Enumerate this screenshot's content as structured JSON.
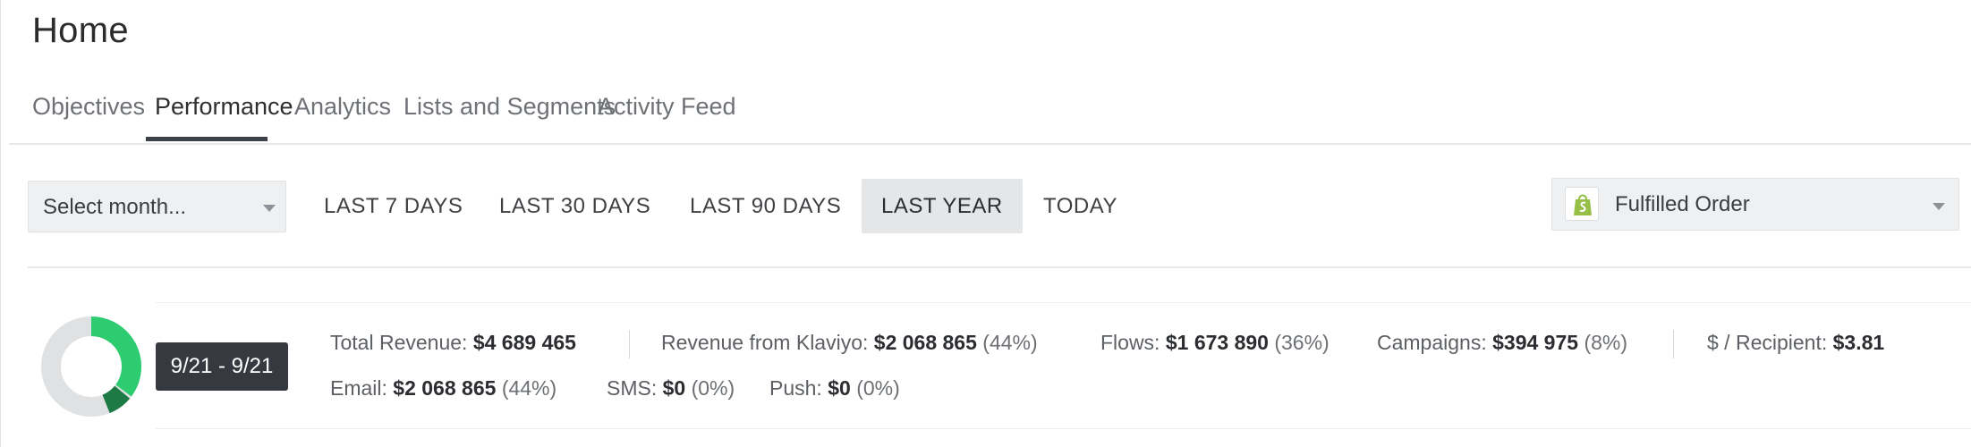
{
  "page": {
    "title": "Home"
  },
  "tabs": [
    {
      "label": "Objectives",
      "active": false
    },
    {
      "label": "Performance",
      "active": true
    },
    {
      "label": "Analytics",
      "active": false
    },
    {
      "label": "Lists and Segments",
      "active": false
    },
    {
      "label": "Activity Feed",
      "active": false
    }
  ],
  "filters": {
    "month_select": {
      "value": "Select month..."
    },
    "ranges": [
      {
        "label": "LAST 7 DAYS",
        "selected": false
      },
      {
        "label": "LAST 30 DAYS",
        "selected": false
      },
      {
        "label": "LAST 90 DAYS",
        "selected": false
      },
      {
        "label": "LAST YEAR",
        "selected": true
      },
      {
        "label": "TODAY",
        "selected": false
      }
    ],
    "metric_select": {
      "value": "Fulfilled Order",
      "icon": "shopify-bag-icon"
    }
  },
  "summary": {
    "tooltip": "9/21 - 9/21",
    "donut": {
      "klaviyo_share": 0.44,
      "flows_share": 0.36,
      "campaigns_share": 0.08
    },
    "row1": [
      {
        "label": "Total Revenue:",
        "value": "$4 689 465",
        "pct": ""
      },
      {
        "label": "Revenue from Klaviyo:",
        "value": "$2 068 865",
        "pct": "(44%)"
      },
      {
        "label": "Flows:",
        "value": "$1 673 890",
        "pct": "(36%)"
      },
      {
        "label": "Campaigns:",
        "value": "$394 975",
        "pct": "(8%)"
      },
      {
        "label": "$ / Recipient:",
        "value": "$3.81",
        "pct": ""
      }
    ],
    "row2": [
      {
        "label": "Email:",
        "value": "$2 068 865",
        "pct": "(44%)"
      },
      {
        "label": "SMS:",
        "value": "$0",
        "pct": "(0%)"
      },
      {
        "label": "Push:",
        "value": "$0",
        "pct": "(0%)"
      }
    ]
  },
  "colors": {
    "donut_track": "#dfe1e3",
    "flows_green": "#2ecc71",
    "campaigns_green": "#1e7a45",
    "tooltip_bg": "#363a40",
    "selected_range_bg": "#e4e6e8"
  }
}
